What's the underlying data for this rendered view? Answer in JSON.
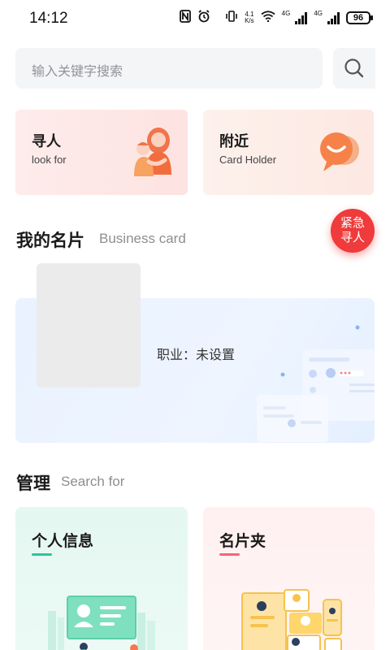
{
  "status_bar": {
    "time": "14:12",
    "net_speed_value": "4.1",
    "net_speed_unit": "K/s",
    "sig1_label": "4G",
    "sig2_label": "4G",
    "battery": "96"
  },
  "search": {
    "placeholder": "输入关键字搜索",
    "icon": "search-icon"
  },
  "quick_cards": [
    {
      "title": "寻人",
      "subtitle": "look for",
      "icon": "mother-child-illustration"
    },
    {
      "title": "附近",
      "subtitle": "Card Holder",
      "icon": "chat-bubble-illustration"
    }
  ],
  "emergency": {
    "line1": "紧急",
    "line2": "寻人",
    "color": "#ef3b3b"
  },
  "my_card": {
    "title": "我的名片",
    "subtitle": "Business card",
    "job_text": "职业：未设置"
  },
  "manage": {
    "title": "管理",
    "subtitle": "Search for",
    "cards": [
      {
        "title": "个人信息",
        "accent": "#2fc39a",
        "icon": "id-card-illustration"
      },
      {
        "title": "名片夹",
        "accent": "#f2667a",
        "icon": "card-holder-illustration"
      }
    ]
  }
}
